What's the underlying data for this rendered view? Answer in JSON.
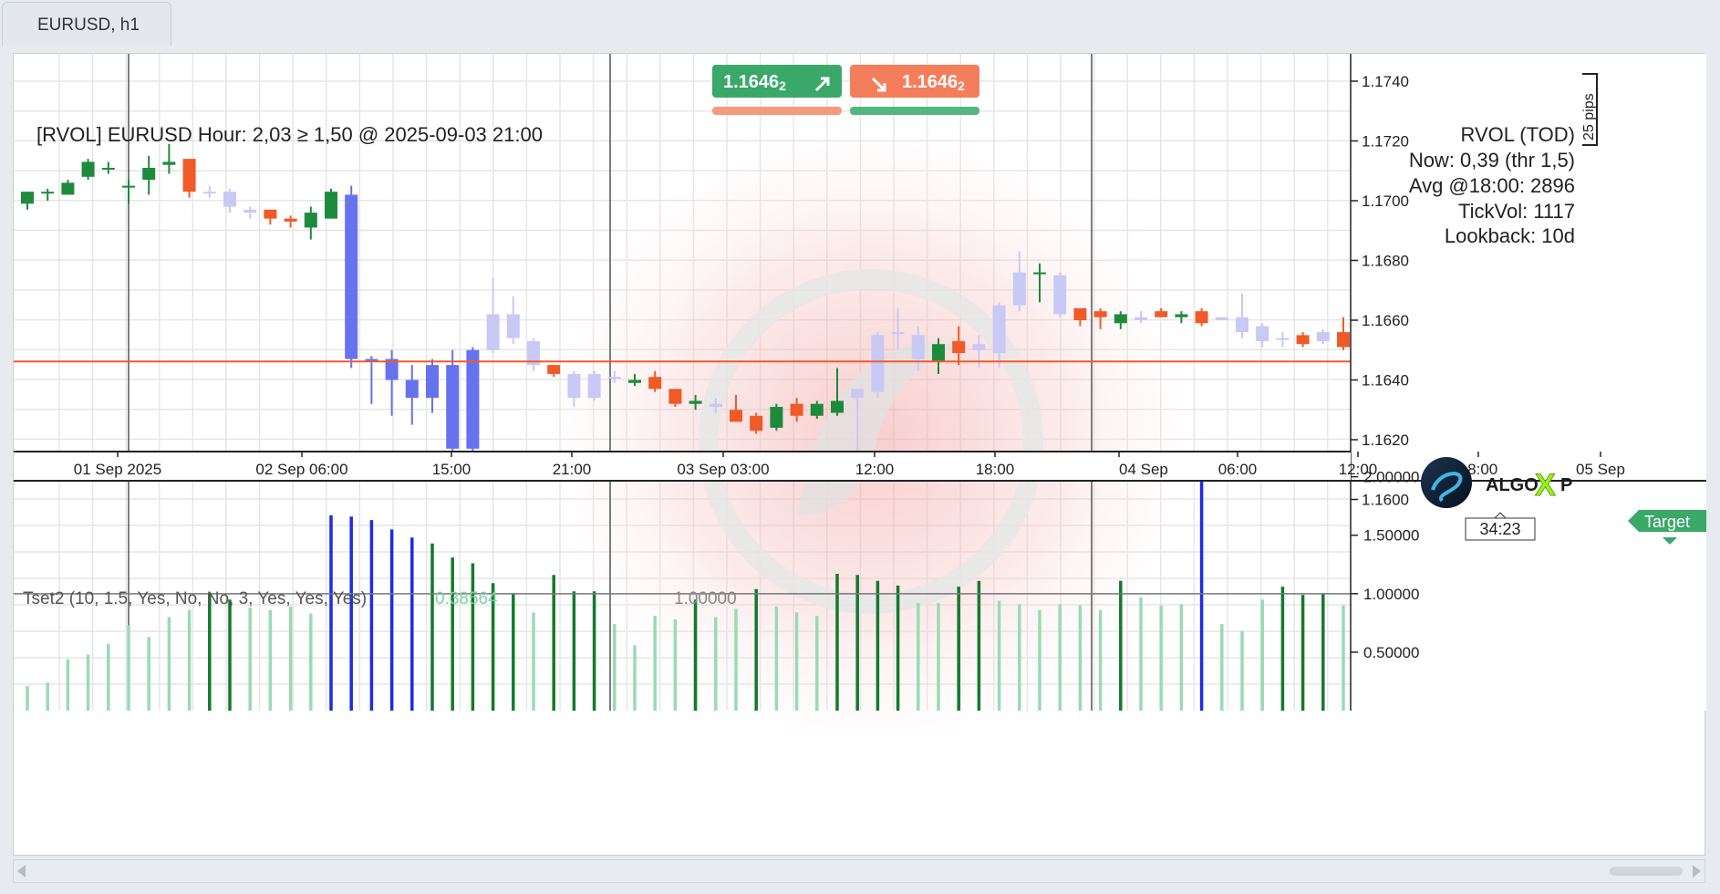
{
  "window": {
    "tab_title": "EURUSD, h1"
  },
  "trade_panel": {
    "buy_price": "1.1646",
    "buy_price_sub": "2",
    "sell_price": "1.1646",
    "sell_price_sub": "2"
  },
  "indicator_title": "[RVOL] EURUSD Hour: 2,03 ≥ 1,50 @ 2025-09-03 21:00",
  "rvol_box": {
    "title": "RVOL (TOD)",
    "lines": [
      "Now: 0,39 (thr 1,5)",
      "Avg @18:00: 2896",
      "TickVol: 1117",
      "Lookback: 10d"
    ]
  },
  "ruler_label": "25 pips",
  "price_axis": {
    "ticks": [
      "1.1740",
      "1.1720",
      "1.1700",
      "1.1680",
      "1.1660",
      "1.1640",
      "1.1620",
      "1.1600"
    ],
    "current_price": "1.16462"
  },
  "logo_text": "ALGO",
  "logo_x": "X",
  "logo_p": "P",
  "target_label": "Target",
  "countdown": "34:23",
  "time_axis": {
    "labels": [
      "01 Sep 2025",
      "02 Sep 06:00",
      "15:00",
      "21:00",
      "03 Sep 03:00",
      "12:00",
      "18:00",
      "04 Sep",
      "06:00",
      "12:00",
      "18:00",
      "05 Sep"
    ]
  },
  "sub_indicator": {
    "label": "Tset2 (10, 1.5, Yes, No, No, 3, Yes, Yes, Yes)",
    "value": "0.38564",
    "level_label": "1.00000",
    "ticks": [
      "2.00000",
      "1.50000",
      "1.00000",
      "0.50000"
    ]
  },
  "colors": {
    "bull": "#1e8a3c",
    "bear": "#f05a28",
    "spike_bull": "#6672ee",
    "spike_bear": "#6672ee",
    "faded": "#c8c9f5",
    "price_line": "#f05a28",
    "buy_button": "#3aa868",
    "sell_button": "#f47e5c",
    "target": "#3aa868",
    "vol_dark": "#137a2c",
    "vol_light": "#98dbb5",
    "vol_spike": "#1e2ce6"
  },
  "chart_data": {
    "type": "candlestick",
    "symbol": "EURUSD",
    "timeframe": "h1",
    "ylim": [
      1.159,
      1.1755
    ],
    "candles": [
      {
        "o": 1.1699,
        "h": 1.1703,
        "l": 1.1697,
        "c": 1.1703,
        "k": "bull"
      },
      {
        "o": 1.1703,
        "h": 1.1704,
        "l": 1.17,
        "c": 1.1703,
        "k": "bull"
      },
      {
        "o": 1.1702,
        "h": 1.1707,
        "l": 1.1702,
        "c": 1.1706,
        "k": "bull"
      },
      {
        "o": 1.1708,
        "h": 1.1714,
        "l": 1.1707,
        "c": 1.1713,
        "k": "bull"
      },
      {
        "o": 1.1711,
        "h": 1.1713,
        "l": 1.1709,
        "c": 1.1711,
        "k": "bull"
      },
      {
        "o": 1.1705,
        "h": 1.1707,
        "l": 1.1699,
        "c": 1.1705,
        "k": "bull"
      },
      {
        "o": 1.1707,
        "h": 1.1715,
        "l": 1.1702,
        "c": 1.1711,
        "k": "bull"
      },
      {
        "o": 1.1712,
        "h": 1.1719,
        "l": 1.1709,
        "c": 1.1713,
        "k": "bull"
      },
      {
        "o": 1.1714,
        "h": 1.1714,
        "l": 1.1701,
        "c": 1.1703,
        "k": "bear"
      },
      {
        "o": 1.1703,
        "h": 1.1705,
        "l": 1.1701,
        "c": 1.1703,
        "k": "faded"
      },
      {
        "o": 1.1703,
        "h": 1.1704,
        "l": 1.1696,
        "c": 1.1698,
        "k": "faded"
      },
      {
        "o": 1.1697,
        "h": 1.1698,
        "l": 1.1694,
        "c": 1.1696,
        "k": "faded"
      },
      {
        "o": 1.1697,
        "h": 1.1697,
        "l": 1.1692,
        "c": 1.1694,
        "k": "bear"
      },
      {
        "o": 1.1694,
        "h": 1.1695,
        "l": 1.1691,
        "c": 1.1693,
        "k": "bear"
      },
      {
        "o": 1.1691,
        "h": 1.1698,
        "l": 1.1687,
        "c": 1.1696,
        "k": "bull"
      },
      {
        "o": 1.1694,
        "h": 1.1704,
        "l": 1.1694,
        "c": 1.1703,
        "k": "bull"
      },
      {
        "o": 1.1702,
        "h": 1.1705,
        "l": 1.1644,
        "c": 1.1647,
        "k": "spike_bear"
      },
      {
        "o": 1.1647,
        "h": 1.1648,
        "l": 1.1632,
        "c": 1.1646,
        "k": "spike_bear"
      },
      {
        "o": 1.1647,
        "h": 1.165,
        "l": 1.1628,
        "c": 1.164,
        "k": "spike_bear"
      },
      {
        "o": 1.164,
        "h": 1.1645,
        "l": 1.1625,
        "c": 1.1634,
        "k": "spike_bear"
      },
      {
        "o": 1.1634,
        "h": 1.1647,
        "l": 1.1629,
        "c": 1.1645,
        "k": "spike_bull"
      },
      {
        "o": 1.1645,
        "h": 1.165,
        "l": 1.1612,
        "c": 1.1617,
        "k": "spike_bear"
      },
      {
        "o": 1.1617,
        "h": 1.1651,
        "l": 1.1613,
        "c": 1.165,
        "k": "spike_bull"
      },
      {
        "o": 1.165,
        "h": 1.1674,
        "l": 1.1649,
        "c": 1.1662,
        "k": "faded"
      },
      {
        "o": 1.1654,
        "h": 1.1668,
        "l": 1.1652,
        "c": 1.1662,
        "k": "faded"
      },
      {
        "o": 1.1653,
        "h": 1.1654,
        "l": 1.1643,
        "c": 1.1645,
        "k": "faded"
      },
      {
        "o": 1.1645,
        "h": 1.1645,
        "l": 1.1641,
        "c": 1.1642,
        "k": "bear"
      },
      {
        "o": 1.1642,
        "h": 1.1643,
        "l": 1.1631,
        "c": 1.1634,
        "k": "faded"
      },
      {
        "o": 1.1642,
        "h": 1.1643,
        "l": 1.1633,
        "c": 1.1634,
        "k": "faded"
      },
      {
        "o": 1.1641,
        "h": 1.1643,
        "l": 1.1639,
        "c": 1.1641,
        "k": "faded"
      },
      {
        "o": 1.1639,
        "h": 1.1642,
        "l": 1.1638,
        "c": 1.164,
        "k": "bull"
      },
      {
        "o": 1.1641,
        "h": 1.1643,
        "l": 1.1636,
        "c": 1.1637,
        "k": "bear"
      },
      {
        "o": 1.1637,
        "h": 1.1637,
        "l": 1.1631,
        "c": 1.1632,
        "k": "bear"
      },
      {
        "o": 1.1632,
        "h": 1.1635,
        "l": 1.163,
        "c": 1.1633,
        "k": "bull"
      },
      {
        "o": 1.1632,
        "h": 1.1634,
        "l": 1.1629,
        "c": 1.1631,
        "k": "faded"
      },
      {
        "o": 1.163,
        "h": 1.1635,
        "l": 1.1626,
        "c": 1.1626,
        "k": "bear"
      },
      {
        "o": 1.1628,
        "h": 1.1629,
        "l": 1.1622,
        "c": 1.1623,
        "k": "bear"
      },
      {
        "o": 1.1624,
        "h": 1.1632,
        "l": 1.1623,
        "c": 1.1631,
        "k": "bull"
      },
      {
        "o": 1.1632,
        "h": 1.1634,
        "l": 1.1626,
        "c": 1.1628,
        "k": "bear"
      },
      {
        "o": 1.1628,
        "h": 1.1633,
        "l": 1.1627,
        "c": 1.1632,
        "k": "bull"
      },
      {
        "o": 1.1629,
        "h": 1.1644,
        "l": 1.1628,
        "c": 1.1633,
        "k": "bull"
      },
      {
        "o": 1.1634,
        "h": 1.1637,
        "l": 1.1608,
        "c": 1.1637,
        "k": "faded"
      },
      {
        "o": 1.1636,
        "h": 1.1656,
        "l": 1.1634,
        "c": 1.1655,
        "k": "faded"
      },
      {
        "o": 1.1656,
        "h": 1.1664,
        "l": 1.165,
        "c": 1.1656,
        "k": "faded"
      },
      {
        "o": 1.1647,
        "h": 1.1658,
        "l": 1.1643,
        "c": 1.1655,
        "k": "faded"
      },
      {
        "o": 1.1646,
        "h": 1.1654,
        "l": 1.1642,
        "c": 1.1652,
        "k": "bull"
      },
      {
        "o": 1.1653,
        "h": 1.1658,
        "l": 1.1645,
        "c": 1.1649,
        "k": "bear"
      },
      {
        "o": 1.165,
        "h": 1.1655,
        "l": 1.1644,
        "c": 1.1652,
        "k": "faded"
      },
      {
        "o": 1.1649,
        "h": 1.1666,
        "l": 1.1644,
        "c": 1.1665,
        "k": "faded"
      },
      {
        "o": 1.1665,
        "h": 1.1683,
        "l": 1.1663,
        "c": 1.1676,
        "k": "faded"
      },
      {
        "o": 1.1676,
        "h": 1.1679,
        "l": 1.1666,
        "c": 1.1676,
        "k": "bull"
      },
      {
        "o": 1.1675,
        "h": 1.1676,
        "l": 1.1661,
        "c": 1.1662,
        "k": "faded"
      },
      {
        "o": 1.1664,
        "h": 1.1664,
        "l": 1.1658,
        "c": 1.166,
        "k": "bear"
      },
      {
        "o": 1.1663,
        "h": 1.1664,
        "l": 1.1657,
        "c": 1.1661,
        "k": "bear"
      },
      {
        "o": 1.1659,
        "h": 1.1663,
        "l": 1.1657,
        "c": 1.1662,
        "k": "bull"
      },
      {
        "o": 1.166,
        "h": 1.1663,
        "l": 1.1659,
        "c": 1.1661,
        "k": "faded"
      },
      {
        "o": 1.1663,
        "h": 1.1664,
        "l": 1.1661,
        "c": 1.1661,
        "k": "bear"
      },
      {
        "o": 1.1661,
        "h": 1.1663,
        "l": 1.1659,
        "c": 1.1662,
        "k": "bull"
      },
      {
        "o": 1.1663,
        "h": 1.1664,
        "l": 1.1658,
        "c": 1.1659,
        "k": "bear"
      },
      {
        "o": 1.1661,
        "h": 1.1661,
        "l": 1.166,
        "c": 1.166,
        "k": "faded"
      },
      {
        "o": 1.1661,
        "h": 1.1669,
        "l": 1.1654,
        "c": 1.1656,
        "k": "faded"
      },
      {
        "o": 1.1658,
        "h": 1.1659,
        "l": 1.1651,
        "c": 1.1653,
        "k": "faded"
      },
      {
        "o": 1.1654,
        "h": 1.1656,
        "l": 1.1651,
        "c": 1.1654,
        "k": "faded"
      },
      {
        "o": 1.1655,
        "h": 1.1656,
        "l": 1.1651,
        "c": 1.1652,
        "k": "bear"
      },
      {
        "o": 1.1656,
        "h": 1.1657,
        "l": 1.1652,
        "c": 1.1653,
        "k": "faded"
      },
      {
        "o": 1.1656,
        "h": 1.1661,
        "l": 1.165,
        "c": 1.1651,
        "k": "bear"
      },
      {
        "o": 1.1653,
        "h": 1.1656,
        "l": 1.1652,
        "c": 1.1653,
        "k": "bear"
      },
      {
        "o": 1.1651,
        "h": 1.1661,
        "l": 1.165,
        "c": 1.166,
        "k": "bull"
      },
      {
        "o": 1.1659,
        "h": 1.166,
        "l": 1.164,
        "c": 1.1643,
        "k": "faded"
      },
      {
        "o": 1.1652,
        "h": 1.1654,
        "l": 1.1642,
        "c": 1.1643,
        "k": "faded"
      },
      {
        "o": 1.1653,
        "h": 1.1654,
        "l": 1.1639,
        "c": 1.1643,
        "k": "bear"
      },
      {
        "o": 1.1643,
        "h": 1.165,
        "l": 1.1631,
        "c": 1.1643,
        "k": "faded"
      },
      {
        "o": 1.1649,
        "h": 1.1652,
        "l": 1.1637,
        "c": 1.1641,
        "k": "faded"
      },
      {
        "o": 1.1639,
        "h": 1.1643,
        "l": 1.1633,
        "c": 1.1635,
        "k": "faded"
      },
      {
        "o": 1.1636,
        "h": 1.165,
        "l": 1.1633,
        "c": 1.1648,
        "k": "bull"
      },
      {
        "o": 1.1649,
        "h": 1.165,
        "l": 1.1636,
        "c": 1.164,
        "k": "bear"
      },
      {
        "o": 1.164,
        "h": 1.1643,
        "l": 1.1636,
        "c": 1.1638,
        "k": "bear"
      },
      {
        "o": 1.1638,
        "h": 1.1647,
        "l": 1.1638,
        "c": 1.1646,
        "k": "bull"
      }
    ],
    "current_price": 1.16462,
    "alert_level": 1.5,
    "volume_reference_level": 1.0,
    "volume_ylim": [
      0,
      2.2
    ],
    "volume_bars": [
      {
        "v": 0.21,
        "k": "light"
      },
      {
        "v": 0.24,
        "k": "light"
      },
      {
        "v": 0.44,
        "k": "light"
      },
      {
        "v": 0.48,
        "k": "light"
      },
      {
        "v": 0.57,
        "k": "light"
      },
      {
        "v": 0.73,
        "k": "light"
      },
      {
        "v": 0.63,
        "k": "light"
      },
      {
        "v": 0.8,
        "k": "light"
      },
      {
        "v": 0.86,
        "k": "light"
      },
      {
        "v": 1.0,
        "k": "dark"
      },
      {
        "v": 0.95,
        "k": "dark"
      },
      {
        "v": 0.88,
        "k": "light"
      },
      {
        "v": 0.86,
        "k": "light"
      },
      {
        "v": 0.89,
        "k": "light"
      },
      {
        "v": 0.83,
        "k": "light"
      },
      {
        "v": 1.67,
        "k": "spike"
      },
      {
        "v": 1.66,
        "k": "spike"
      },
      {
        "v": 1.63,
        "k": "spike"
      },
      {
        "v": 1.55,
        "k": "spike"
      },
      {
        "v": 1.48,
        "k": "spike"
      },
      {
        "v": 1.43,
        "k": "dark"
      },
      {
        "v": 1.31,
        "k": "dark"
      },
      {
        "v": 1.26,
        "k": "dark"
      },
      {
        "v": 1.09,
        "k": "dark"
      },
      {
        "v": 1.0,
        "k": "dark"
      },
      {
        "v": 0.84,
        "k": "light"
      },
      {
        "v": 1.16,
        "k": "dark"
      },
      {
        "v": 1.02,
        "k": "dark"
      },
      {
        "v": 1.02,
        "k": "dark"
      },
      {
        "v": 0.74,
        "k": "light"
      },
      {
        "v": 0.56,
        "k": "light"
      },
      {
        "v": 0.81,
        "k": "light"
      },
      {
        "v": 0.78,
        "k": "light"
      },
      {
        "v": 0.95,
        "k": "dark"
      },
      {
        "v": 0.8,
        "k": "light"
      },
      {
        "v": 0.87,
        "k": "light"
      },
      {
        "v": 1.04,
        "k": "dark"
      },
      {
        "v": 0.89,
        "k": "light"
      },
      {
        "v": 0.84,
        "k": "light"
      },
      {
        "v": 0.81,
        "k": "light"
      },
      {
        "v": 1.17,
        "k": "dark"
      },
      {
        "v": 1.16,
        "k": "dark"
      },
      {
        "v": 1.11,
        "k": "dark"
      },
      {
        "v": 1.07,
        "k": "dark"
      },
      {
        "v": 0.92,
        "k": "light"
      },
      {
        "v": 0.92,
        "k": "light"
      },
      {
        "v": 1.06,
        "k": "dark"
      },
      {
        "v": 1.11,
        "k": "dark"
      },
      {
        "v": 0.94,
        "k": "light"
      },
      {
        "v": 0.91,
        "k": "light"
      },
      {
        "v": 0.86,
        "k": "light"
      },
      {
        "v": 0.91,
        "k": "light"
      },
      {
        "v": 0.9,
        "k": "light"
      },
      {
        "v": 0.86,
        "k": "light"
      },
      {
        "v": 1.11,
        "k": "dark"
      },
      {
        "v": 0.97,
        "k": "light"
      },
      {
        "v": 0.9,
        "k": "light"
      },
      {
        "v": 0.91,
        "k": "light"
      },
      {
        "v": 2.03,
        "k": "spike"
      },
      {
        "v": 0.74,
        "k": "light"
      },
      {
        "v": 0.68,
        "k": "light"
      },
      {
        "v": 0.95,
        "k": "light"
      },
      {
        "v": 1.06,
        "k": "dark"
      },
      {
        "v": 0.99,
        "k": "dark"
      },
      {
        "v": 1.0,
        "k": "dark"
      },
      {
        "v": 0.9,
        "k": "light"
      },
      {
        "v": 0.7,
        "k": "light"
      },
      {
        "v": 0.94,
        "k": "dark"
      },
      {
        "v": 0.88,
        "k": "light"
      },
      {
        "v": 0.83,
        "k": "light"
      },
      {
        "v": 0.87,
        "k": "light"
      },
      {
        "v": 1.0,
        "k": "dark"
      },
      {
        "v": 1.04,
        "k": "dark"
      },
      {
        "v": 0.96,
        "k": "light"
      },
      {
        "v": 1.23,
        "k": "dark"
      },
      {
        "v": 1.04,
        "k": "dark"
      },
      {
        "v": 1.01,
        "k": "dark"
      },
      {
        "v": 0.81,
        "k": "light"
      },
      {
        "v": 0.79,
        "k": "light"
      },
      {
        "v": 0.71,
        "k": "light"
      },
      {
        "v": 0.34,
        "k": "light"
      }
    ]
  }
}
